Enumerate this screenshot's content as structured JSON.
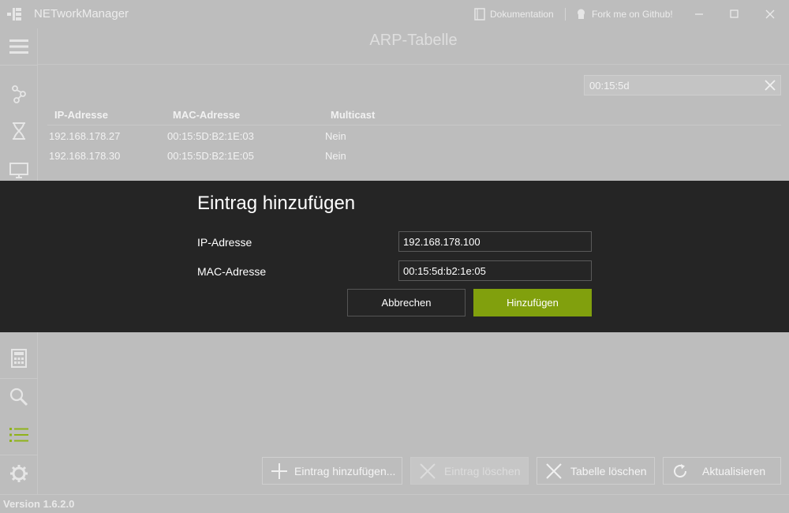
{
  "app": {
    "title": "NETworkManager",
    "version": "Version 1.6.2.0"
  },
  "titlebar": {
    "docs_label": "Dokumentation",
    "github_label": "Fork me on Github!"
  },
  "page": {
    "title": "ARP-Tabelle"
  },
  "search": {
    "value": "00:15:5d"
  },
  "table": {
    "columns": [
      "IP-Adresse",
      "MAC-Adresse",
      "Multicast"
    ],
    "rows": [
      [
        "192.168.178.27",
        "00:15:5D:B2:1E:03",
        "Nein"
      ],
      [
        "192.168.178.30",
        "00:15:5D:B2:1E:05",
        "Nein"
      ]
    ]
  },
  "dialog": {
    "title": "Eintrag hinzufügen",
    "ip_label": "IP-Adresse",
    "ip_value": "192.168.178.100",
    "mac_label": "MAC-Adresse",
    "mac_value": "00:15:5d:b2:1e:05",
    "cancel_label": "Abbrechen",
    "add_label": "Hinzufügen"
  },
  "toolbar": {
    "add_entry_label": "Eintrag hinzufügen...",
    "delete_entry_label": "Eintrag löschen",
    "clear_table_label": "Tabelle löschen",
    "refresh_label": "Aktualisieren"
  },
  "sidebar": {
    "items": [
      "menu-icon",
      "network-icon",
      "dns-icon",
      "monitor-icon",
      "calculator-icon",
      "search-icon",
      "list-icon",
      "settings-icon"
    ],
    "active_item": "list-icon"
  },
  "colors": {
    "accent": "#81a00d",
    "dialog_bg": "#252525",
    "overlay_bg": "#bdbdbd"
  }
}
